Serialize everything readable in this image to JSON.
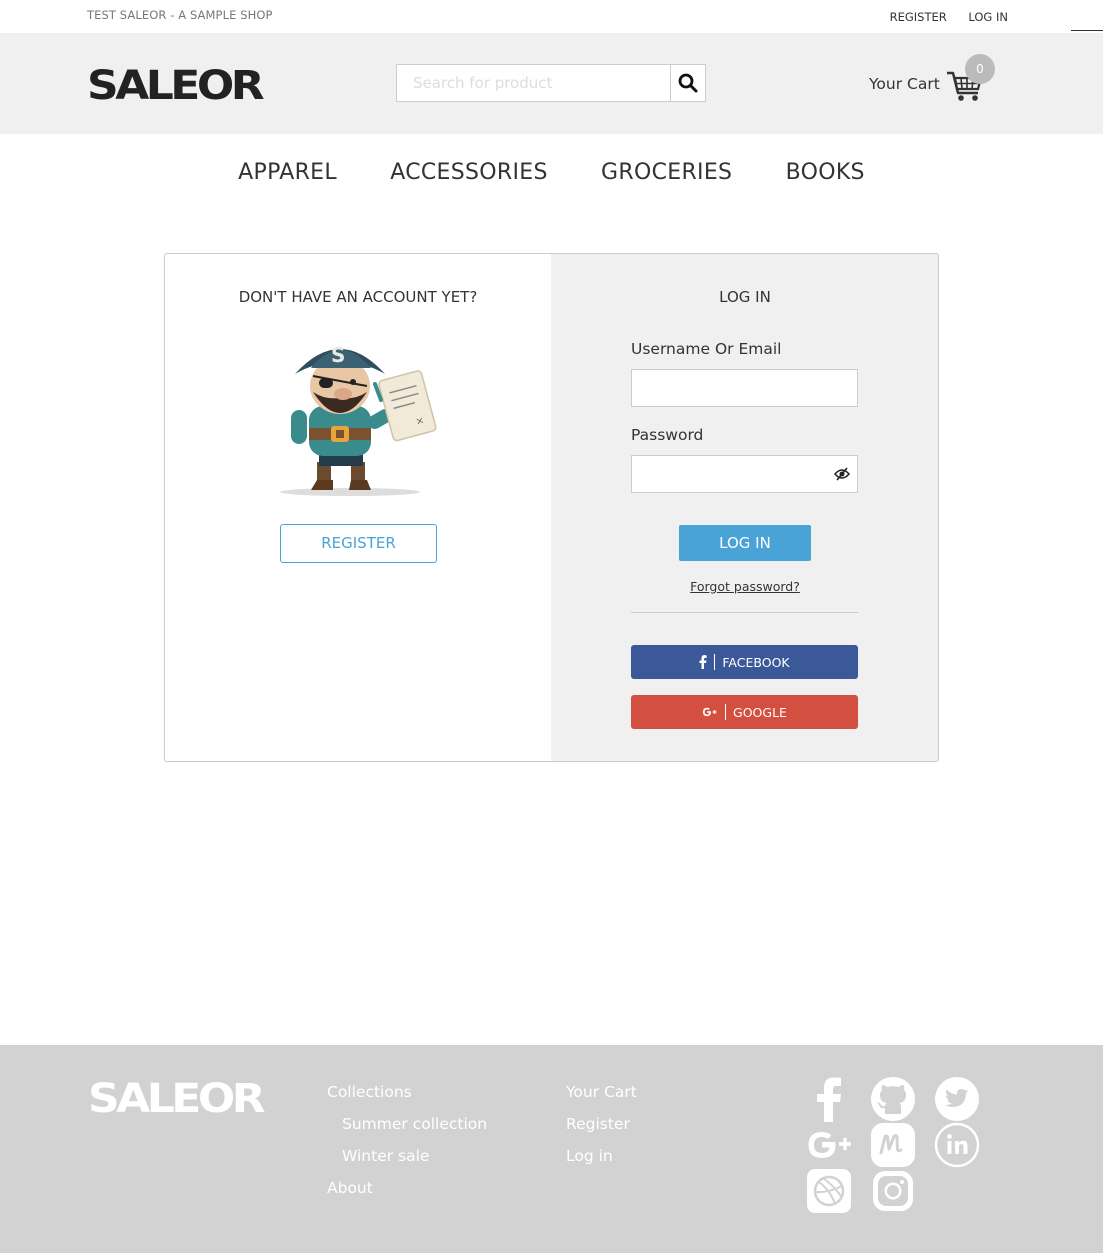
{
  "topbar": {
    "shop_name": "TEST SALEOR - A SAMPLE SHOP",
    "register": "REGISTER",
    "login": "LOG IN"
  },
  "header": {
    "logo": "SALEOR",
    "search_placeholder": "Search for product",
    "cart_label": "Your Cart",
    "cart_count": "0"
  },
  "nav": {
    "items": [
      "APPAREL",
      "ACCESSORIES",
      "GROCERIES",
      "BOOKS"
    ]
  },
  "register_panel": {
    "heading": "DON'T HAVE AN ACCOUNT YET?",
    "button": "REGISTER"
  },
  "login_panel": {
    "heading": "LOG IN",
    "username_label": "Username Or Email",
    "password_label": "Password",
    "button": "LOG IN",
    "forgot": "Forgot password?",
    "facebook": "FACEBOOK",
    "google": "GOOGLE"
  },
  "footer": {
    "logo": "SALEOR",
    "col1": {
      "collections": "Collections",
      "summer": "Summer collection",
      "winter": "Winter sale",
      "about": "About"
    },
    "col2": {
      "cart": "Your Cart",
      "register": "Register",
      "login": "Log in"
    },
    "social_icons": [
      "facebook-icon",
      "github-icon",
      "twitter-icon",
      "google-plus-icon",
      "meetup-icon",
      "linkedin-icon",
      "dribbble-icon",
      "instagram-icon"
    ]
  },
  "colors": {
    "accent": "#4aa3d6",
    "facebook": "#3b5998",
    "google": "#d34f3f",
    "header_bg": "#f0f0f0",
    "footer_bg": "#d2d2d2"
  }
}
